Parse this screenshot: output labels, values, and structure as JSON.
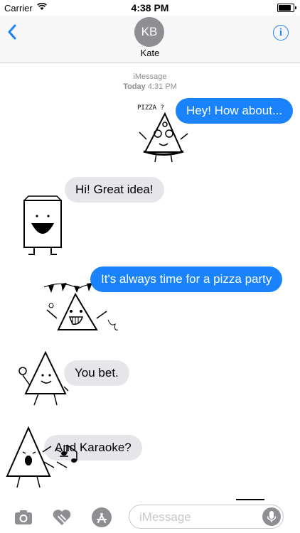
{
  "status_bar": {
    "carrier": "Carrier",
    "time": "4:38 PM"
  },
  "header": {
    "avatar_initials": "KB",
    "contact_name": "Kate"
  },
  "thread": {
    "service": "iMessage",
    "day": "Today",
    "time": "4:31 PM",
    "messages": [
      {
        "direction": "outgoing",
        "text": "Hey! How about..."
      },
      {
        "direction": "incoming",
        "text": "Hi! Great idea!"
      },
      {
        "direction": "outgoing",
        "text": "It's always time for a pizza party"
      },
      {
        "direction": "incoming",
        "text": "You bet."
      },
      {
        "direction": "incoming",
        "text": "And Karaoke?"
      }
    ],
    "stickers": [
      {
        "name": "pizza-slice-sticker",
        "caption": "PIZZA ?"
      },
      {
        "name": "milk-carton-sticker"
      },
      {
        "name": "party-triangle-sticker"
      },
      {
        "name": "waving-triangle-sticker"
      },
      {
        "name": "singing-triangle-sticker"
      }
    ]
  },
  "input_bar": {
    "placeholder": "iMessage",
    "value": ""
  },
  "colors": {
    "outgoing_bubble": "#1a82fb",
    "incoming_bubble": "#e5e5ea",
    "accent": "#1a82fb",
    "avatar": "#8e8e93"
  },
  "icons": [
    "back-chevron-icon",
    "info-icon",
    "camera-icon",
    "digital-touch-icon",
    "app-store-icon",
    "microphone-icon",
    "wifi-icon",
    "battery-icon"
  ]
}
